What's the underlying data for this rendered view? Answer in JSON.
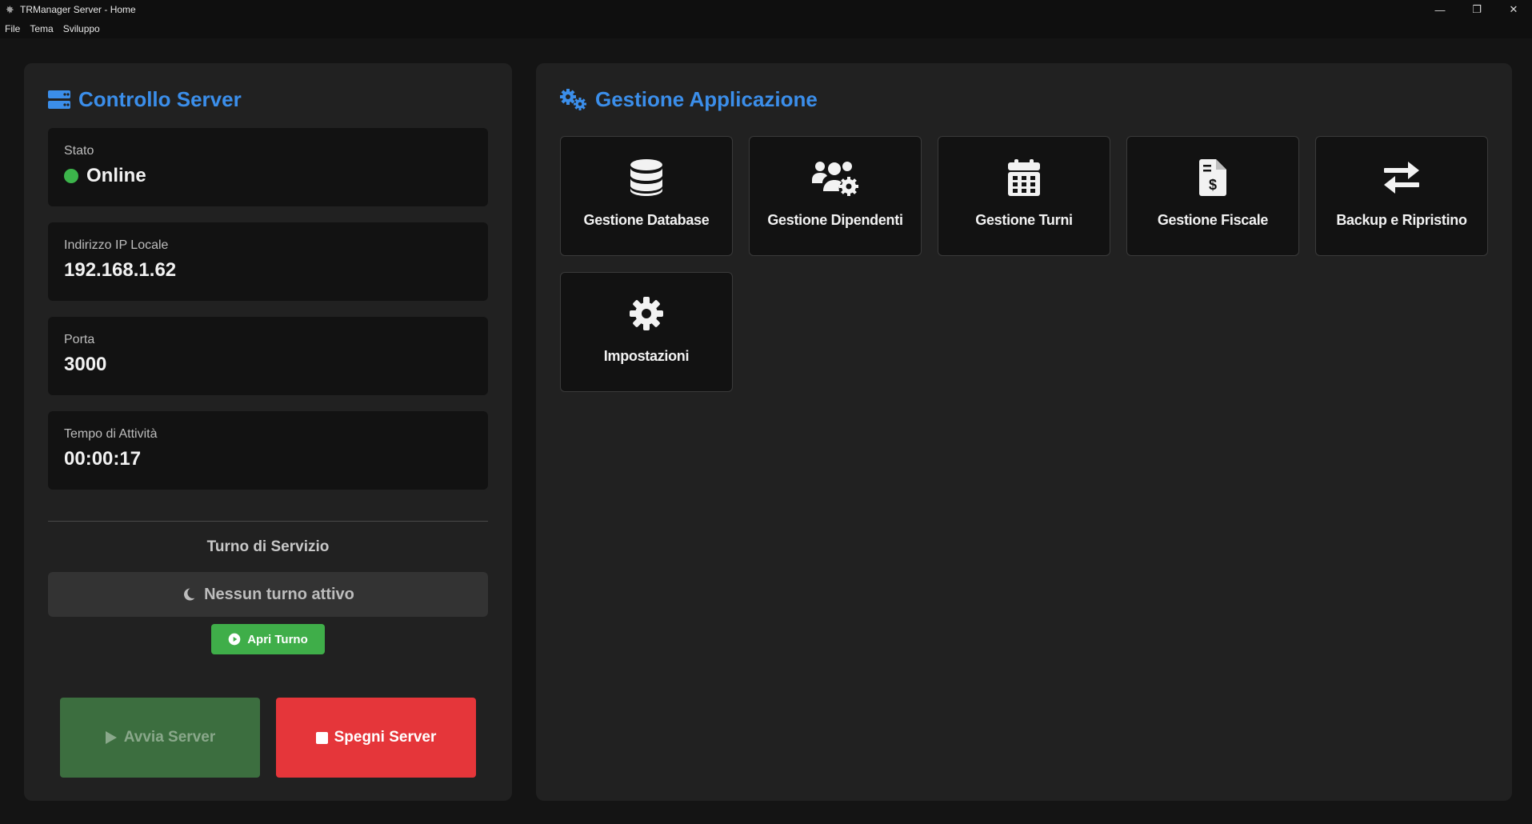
{
  "window": {
    "title": "TRManager Server - Home",
    "controls": {
      "minimize": "—",
      "restore": "❐",
      "close": "✕"
    }
  },
  "menu": {
    "items": [
      "File",
      "Tema",
      "Sviluppo"
    ]
  },
  "server_panel": {
    "heading": "Controllo Server",
    "heading_icon": "server-icon",
    "status": {
      "label": "Stato",
      "value": "Online",
      "color": "#3cb44b"
    },
    "ip": {
      "label": "Indirizzo IP Locale",
      "value": "192.168.1.62"
    },
    "port": {
      "label": "Porta",
      "value": "3000"
    },
    "uptime": {
      "label": "Tempo di Attività",
      "value": "00:00:17"
    },
    "shift": {
      "title": "Turno di Servizio",
      "status": "Nessun turno attivo",
      "status_icon": "moon-icon",
      "open_button": "Apri Turno"
    },
    "start_button": "Avvia Server",
    "stop_button": "Spegni Server"
  },
  "app_panel": {
    "heading": "Gestione Applicazione",
    "heading_icon": "gears-icon",
    "tiles": [
      {
        "label": "Gestione Database",
        "icon": "database-icon"
      },
      {
        "label": "Gestione Dipendenti",
        "icon": "users-gear-icon"
      },
      {
        "label": "Gestione Turni",
        "icon": "calendar-icon"
      },
      {
        "label": "Gestione Fiscale",
        "icon": "file-invoice-dollar-icon"
      },
      {
        "label": "Backup e Ripristino",
        "icon": "exchange-arrows-icon"
      },
      {
        "label": "Impostazioni",
        "icon": "gear-icon"
      }
    ]
  },
  "colors": {
    "accent": "#3b8eea",
    "success": "#3fae49",
    "danger": "#e5363a"
  }
}
